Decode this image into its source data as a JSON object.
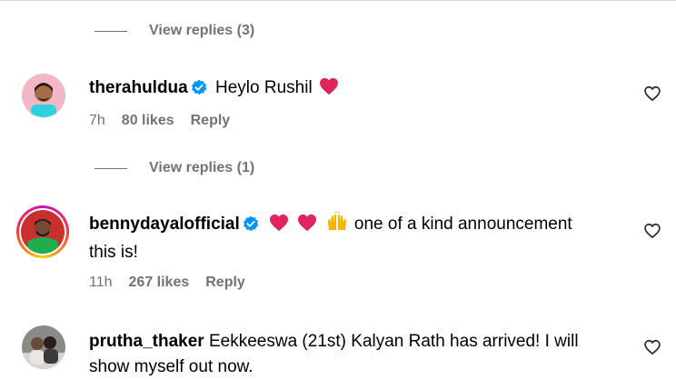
{
  "thread": {
    "view_replies_1": "View replies (3)",
    "view_replies_2": "View replies (1)"
  },
  "comments": [
    {
      "username": "therahuldua",
      "verified": true,
      "text": "Heylo Rushil",
      "emoji": [
        "red-heart"
      ],
      "time": "7h",
      "likes": "80 likes",
      "reply": "Reply"
    },
    {
      "username": "bennydayalofficial",
      "verified": true,
      "emoji": [
        "red-heart",
        "red-heart",
        "raising-hands"
      ],
      "text": "one of a kind announcement",
      "text_line2": "this is!",
      "time": "11h",
      "likes": "267 likes",
      "reply": "Reply",
      "story_ring": true
    },
    {
      "username": "prutha_thaker",
      "verified": false,
      "text": "Eekkeeswa (21st) Kalyan Rath has arrived! I will",
      "text_line2": "show myself out now."
    }
  ],
  "colors": {
    "secondary_text": "#737373",
    "verified_badge": "#0095f6",
    "heart": "#e0245e"
  }
}
